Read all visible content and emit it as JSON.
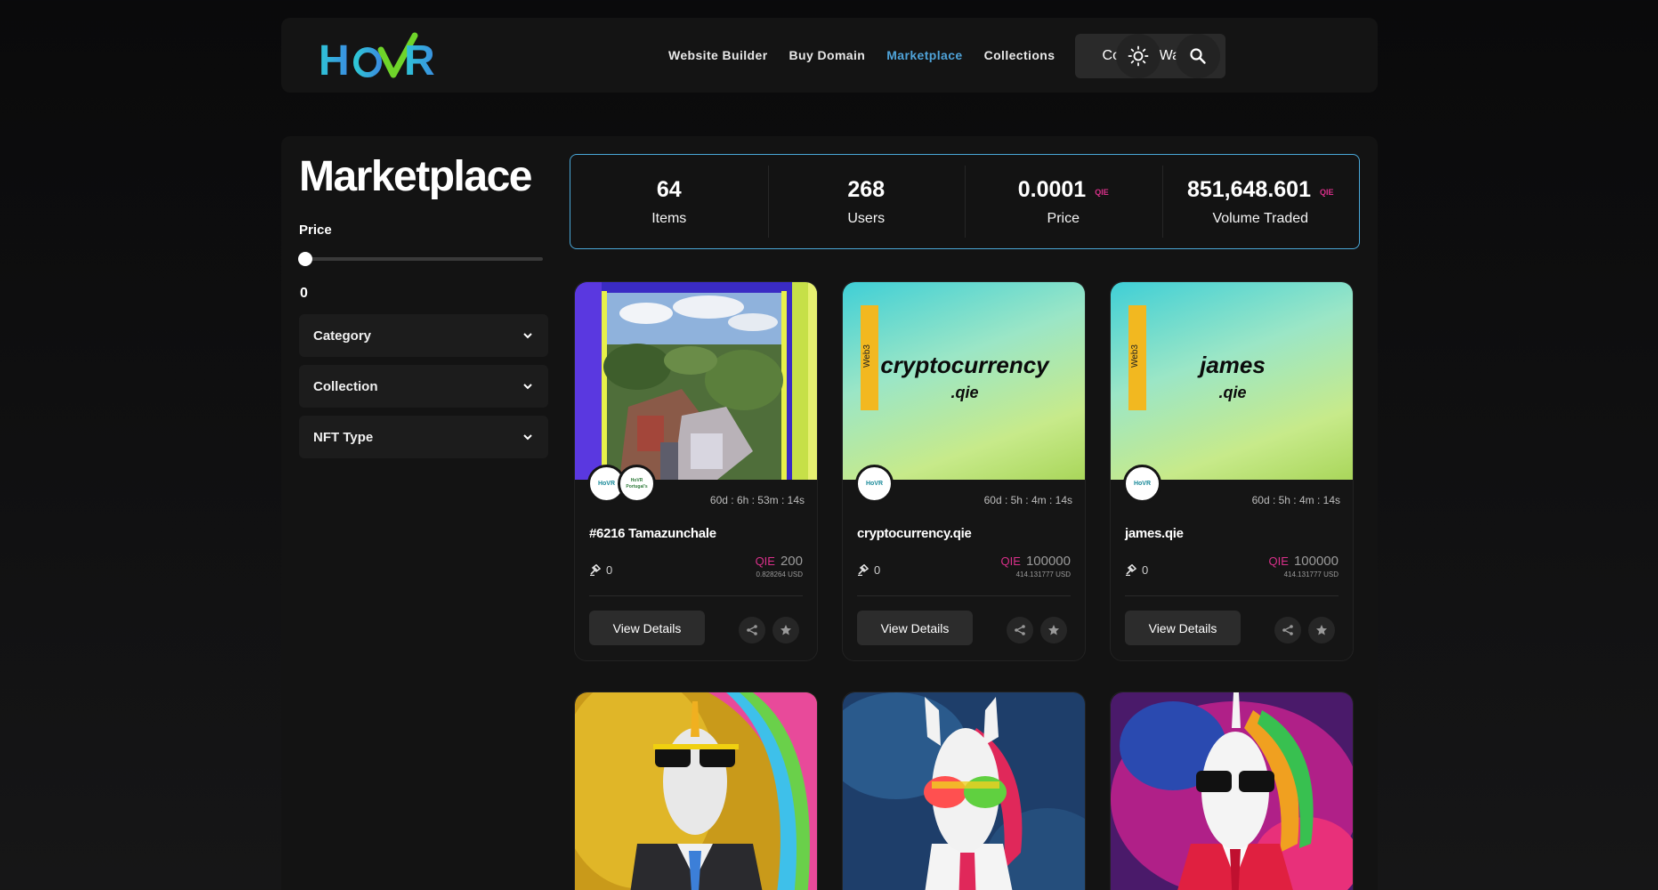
{
  "header": {
    "logo_text": "HoVR",
    "nav": [
      {
        "label": "Website Builder"
      },
      {
        "label": "Buy Domain"
      },
      {
        "label": "Marketplace"
      },
      {
        "label": "Collections"
      }
    ],
    "connect_label": "Connect Wallet",
    "theme_icon": "sun-icon",
    "search_icon": "search-icon",
    "active_color": "#4fa3d9"
  },
  "sidebar": {
    "title": "Marketplace",
    "price_label": "Price",
    "price_value": "0",
    "price_slider_fraction": 0,
    "dropdowns": [
      {
        "label": "Category"
      },
      {
        "label": "Collection"
      },
      {
        "label": "NFT Type"
      }
    ]
  },
  "stats": [
    {
      "value": "64",
      "label": "Items",
      "currency": ""
    },
    {
      "value": "268",
      "label": "Users",
      "currency": ""
    },
    {
      "value": "0.0001",
      "label": "Price",
      "currency": "QIE"
    },
    {
      "value": "851,648.601",
      "label": "Volume Traded",
      "currency": "QIE"
    }
  ],
  "cards": [
    {
      "name": "#6216 Tamazunchale",
      "timer": "60d : 6h : 53m : 14s",
      "bids": "0",
      "currency": "QIE",
      "price": "200",
      "usd": "0.828264 USD",
      "view_label": "View Details",
      "avatar1": "HoVR",
      "avatar2": "HoVR Portugal's"
    },
    {
      "name": "cryptocurrency.qie",
      "timer": "60d : 5h : 4m : 14s",
      "bids": "0",
      "currency": "QIE",
      "price": "100000",
      "usd": "414.131777 USD",
      "view_label": "View Details",
      "avatar1": "HoVR",
      "tag": "Web3",
      "domain_top": "cryptocurrency",
      "domain_bottom": ".qie"
    },
    {
      "name": "james.qie",
      "timer": "60d : 5h : 4m : 14s",
      "bids": "0",
      "currency": "QIE",
      "price": "100000",
      "usd": "414.131777 USD",
      "view_label": "View Details",
      "avatar1": "HoVR",
      "tag": "Web3",
      "domain_top": "james",
      "domain_bottom": ".qie"
    }
  ],
  "colors": {
    "stats_border": "#4aa8d8",
    "qie": "#d9308a"
  }
}
